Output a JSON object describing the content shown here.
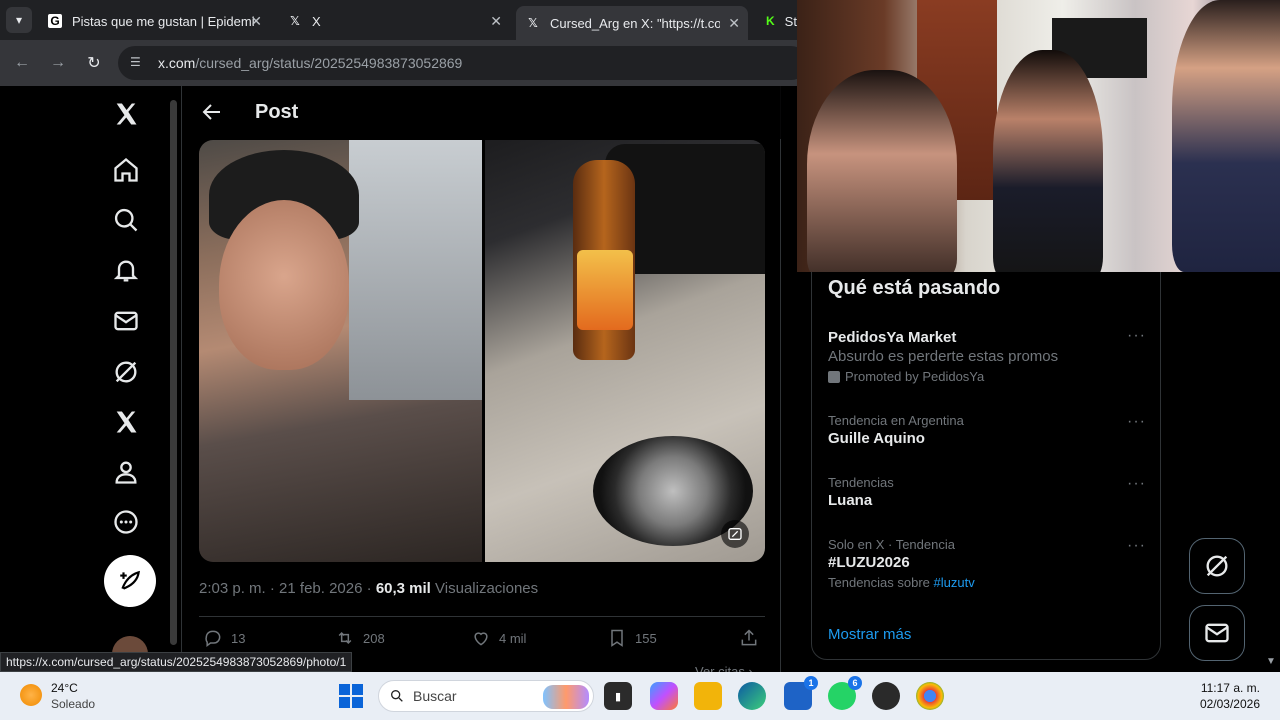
{
  "browser": {
    "tabs": [
      {
        "title": "Pistas que me gustan | Epidemi",
        "favicon": "genius-icon"
      },
      {
        "title": "X",
        "favicon": "x-icon"
      },
      {
        "title": "Cursed_Arg en X: \"https://t.co/(",
        "favicon": "x-icon",
        "active": true
      },
      {
        "title": "St",
        "favicon": "kick-icon"
      }
    ],
    "url_host": "x.com",
    "url_path": "/cursed_arg/status/2025254983873052869",
    "status_url": "https://x.com/cursed_arg/status/2025254983873052869/photo/1"
  },
  "header": {
    "title": "Post"
  },
  "post": {
    "time": "2:03 p. m.",
    "date": "21 feb. 2026",
    "views_count": "60,3 mil",
    "views_label": "Visualizaciones",
    "replies": "13",
    "reposts": "208",
    "likes": "4 mil",
    "bookmarks": "155",
    "quotes_link": "Ver citas ›"
  },
  "trends": {
    "title": "Qué está pasando",
    "items": [
      {
        "name": "PedidosYa Market",
        "desc": "Absurdo es perderte estas promos",
        "promo": "Promoted by PedidosYa"
      },
      {
        "category": "Tendencia en Argentina",
        "name": "Guille Aquino"
      },
      {
        "category": "Tendencias",
        "name": "Luana"
      },
      {
        "category": "Solo en X · Tendencia",
        "name": "#LUZU2026",
        "sub_prefix": "Tendencias sobre",
        "sub_link": "#luzutv"
      }
    ],
    "show_more": "Mostrar más"
  },
  "taskbar": {
    "temp": "24°C",
    "condition": "Soleado",
    "search_placeholder": "Buscar",
    "time": "11:17 a. m.",
    "date": "02/03/2026",
    "store_badge": "1",
    "whatsapp_badge": "6"
  },
  "colors": {
    "accent": "#1d9bf0",
    "background": "#000000",
    "taskbar": "#e9eef5"
  }
}
